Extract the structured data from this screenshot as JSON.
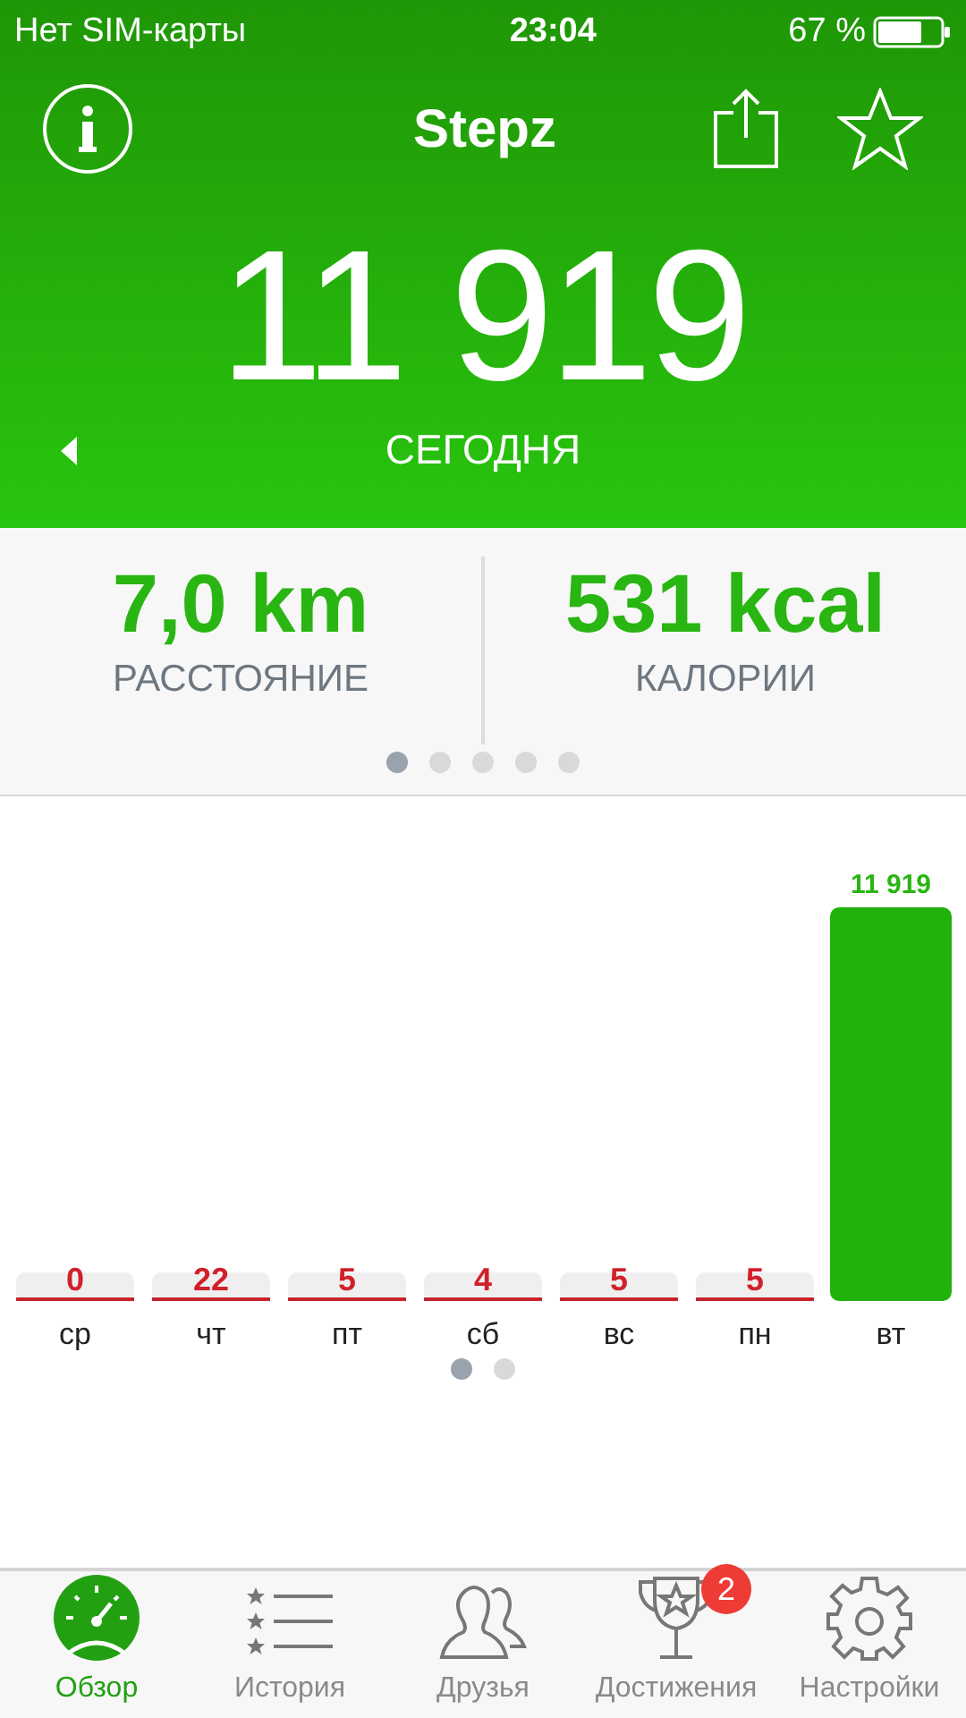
{
  "status_bar": {
    "carrier": "Нет SIM-карты",
    "time": "23:04",
    "battery": "67 %"
  },
  "nav": {
    "title": "Stepz"
  },
  "today": {
    "steps": "11 919",
    "label": "СЕГОДНЯ"
  },
  "stats": [
    {
      "value": "7,0 km",
      "label": "РАССТОЯНИЕ"
    },
    {
      "value": "531 kcal",
      "label": "КАЛОРИИ"
    }
  ],
  "stats_pager": [
    {
      "selected": true
    },
    {
      "selected": false
    },
    {
      "selected": false
    },
    {
      "selected": false
    },
    {
      "selected": false
    }
  ],
  "chart_data": {
    "type": "bar",
    "categories": [
      "ср",
      "чт",
      "пт",
      "сб",
      "вс",
      "пн",
      "вт"
    ],
    "series": [
      {
        "color": "#22b20c",
        "values": [
          0,
          22,
          5,
          4,
          5,
          5,
          11919
        ]
      }
    ],
    "data_labels": true,
    "value_labels": [
      "0",
      "22",
      "5",
      "4",
      "5",
      "5",
      "11 919"
    ]
  },
  "chart_pager": [
    {
      "selected": true
    },
    {
      "selected": false
    }
  ],
  "tabs": [
    {
      "label": "Обзор",
      "selected": true,
      "kind": "overview"
    },
    {
      "label": "История",
      "selected": false,
      "kind": "history"
    },
    {
      "label": "Друзья",
      "selected": false,
      "kind": "friends"
    },
    {
      "label": "Достижения",
      "selected": false,
      "kind": "achievements",
      "badge": "2"
    },
    {
      "label": "Настройки",
      "selected": false,
      "kind": "settings"
    }
  ]
}
